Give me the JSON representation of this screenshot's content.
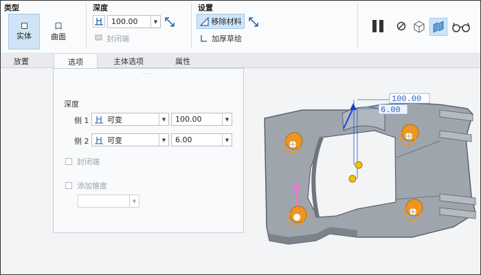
{
  "ribbon": {
    "type": {
      "title": "类型",
      "solid_label": "实体",
      "surface_label": "曲面"
    },
    "depth": {
      "title": "深度",
      "value": "100.00",
      "close_label": "封闭端"
    },
    "settings": {
      "title": "设置",
      "remove_material_label": "移除材料",
      "thicken_label": "加厚草绘"
    }
  },
  "tabs": [
    {
      "label": "放置"
    },
    {
      "label": "选项"
    },
    {
      "label": "主体选项"
    },
    {
      "label": "属性"
    }
  ],
  "options": {
    "depth_heading": "深度",
    "side1": {
      "label": "侧 1",
      "type": "可变",
      "value": "100.00"
    },
    "side2": {
      "label": "侧 2",
      "type": "可变",
      "value": "6.00"
    },
    "close_label": "封闭端",
    "taper_label": "添加锥度"
  },
  "viewport": {
    "dim1": "100.00",
    "dim2": "6.00",
    "tag": "1"
  },
  "colors": {
    "accent_orange": "#f0961e",
    "model_gray": "#9ea5ad",
    "active_blue": "#cfe5f7"
  }
}
